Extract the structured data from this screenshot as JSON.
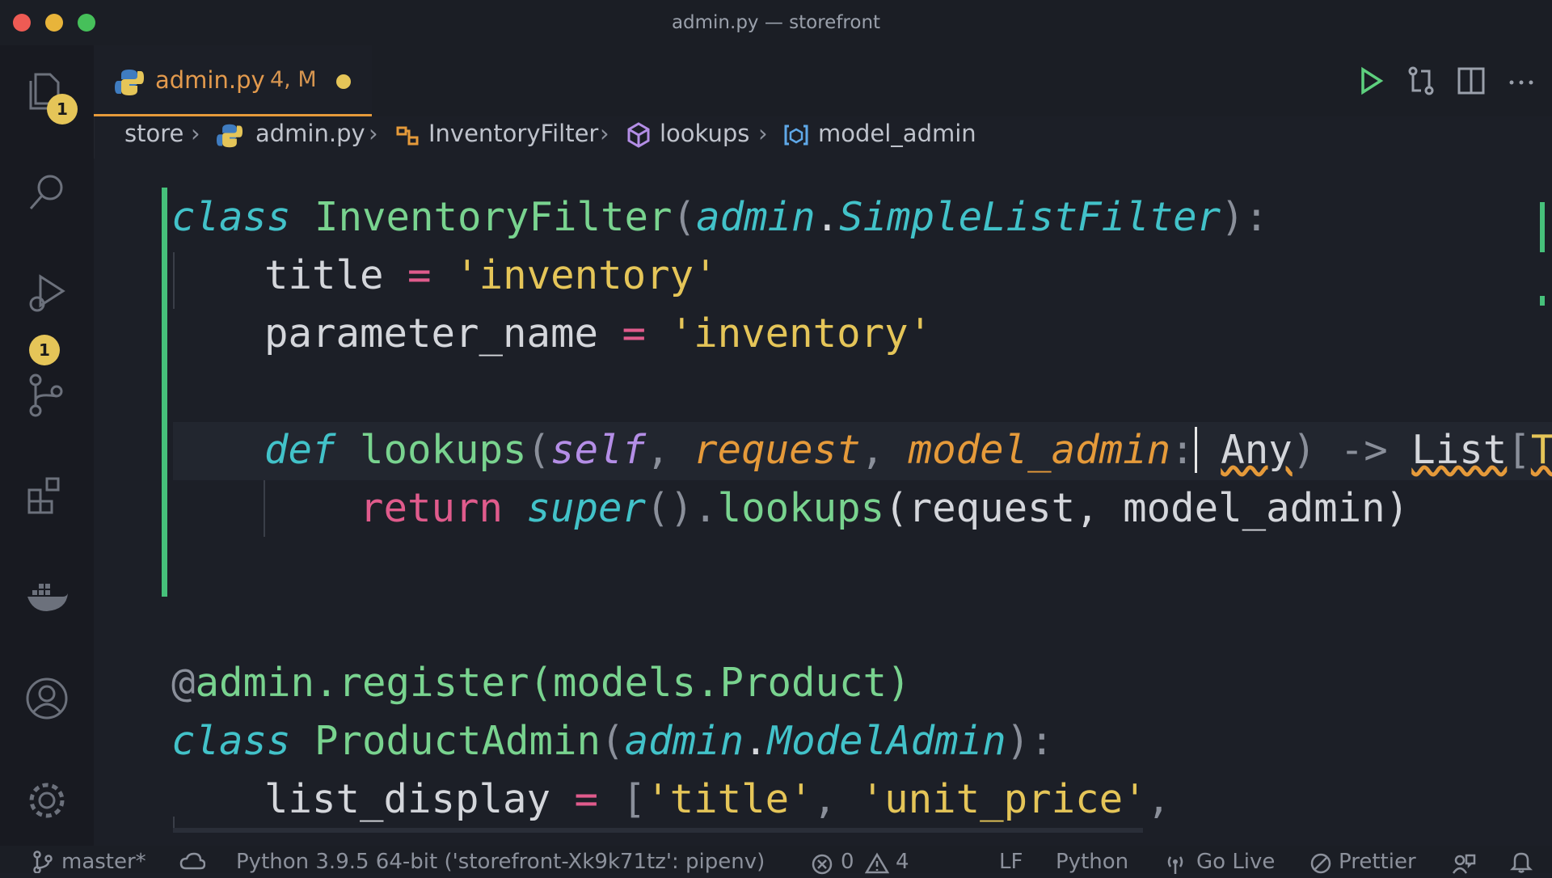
{
  "window": {
    "title": "admin.py — storefront"
  },
  "activity_bar": {
    "explorer_badge": "1",
    "source_control_badge": "1"
  },
  "tab": {
    "name": "admin.py",
    "status": "4, M"
  },
  "breadcrumb": [
    "store",
    "admin.py",
    "InventoryFilter",
    "lookups",
    "model_admin"
  ],
  "code": {
    "l1": {
      "kw": "class",
      "name": "InventoryFilter",
      "p1": "(",
      "base_mod": "admin",
      "dot": ".",
      "base_cls": "SimpleListFilter",
      "p2": "):"
    },
    "l2": {
      "name": "title",
      "eq": "=",
      "val": "'inventory'"
    },
    "l3": {
      "name": "parameter_name",
      "eq": "=",
      "val": "'inventory'"
    },
    "l5": {
      "kw": "def",
      "fn": "lookups",
      "p1": "(",
      "self": "self",
      "c1": ",",
      "arg1": "request",
      "c2": ",",
      "arg2": "model_admin",
      "colon": ":",
      "type": "Any",
      "p2": ")",
      "arrow": "->",
      "ret": "List",
      "br": "[",
      "tu": "Tu"
    },
    "l6": {
      "kw": "return",
      "sup": "super",
      "rest1": "().",
      "fn": "lookups",
      "rest2": "(request, model_admin)"
    },
    "l9": {
      "at": "@",
      "text": "admin.register(models.Product)"
    },
    "l10": {
      "kw": "class",
      "name": "ProductAdmin",
      "p1": "(",
      "base_mod": "admin",
      "dot": ".",
      "base_cls": "ModelAdmin",
      "p2": "):"
    },
    "l11": {
      "name": "list_display",
      "eq": "=",
      "br": "[",
      "s1": "'title'",
      "c": ",",
      "s2": "'unit_price'",
      "c2": ","
    }
  },
  "status": {
    "branch": "master*",
    "interpreter": "Python 3.9.5 64-bit ('storefront-Xk9k71tz': pipenv)",
    "errors": "0",
    "warnings": "4",
    "eol": "LF",
    "language": "Python",
    "go_live": "Go Live",
    "prettier": "Prettier"
  },
  "colors": {
    "accent": "#e59a3a",
    "badge": "#e5c558",
    "modified_gutter": "#46c07a",
    "keyword": "#42c2c9",
    "class_name": "#79d38f",
    "string": "#e5c558",
    "operator": "#e05b8c"
  }
}
